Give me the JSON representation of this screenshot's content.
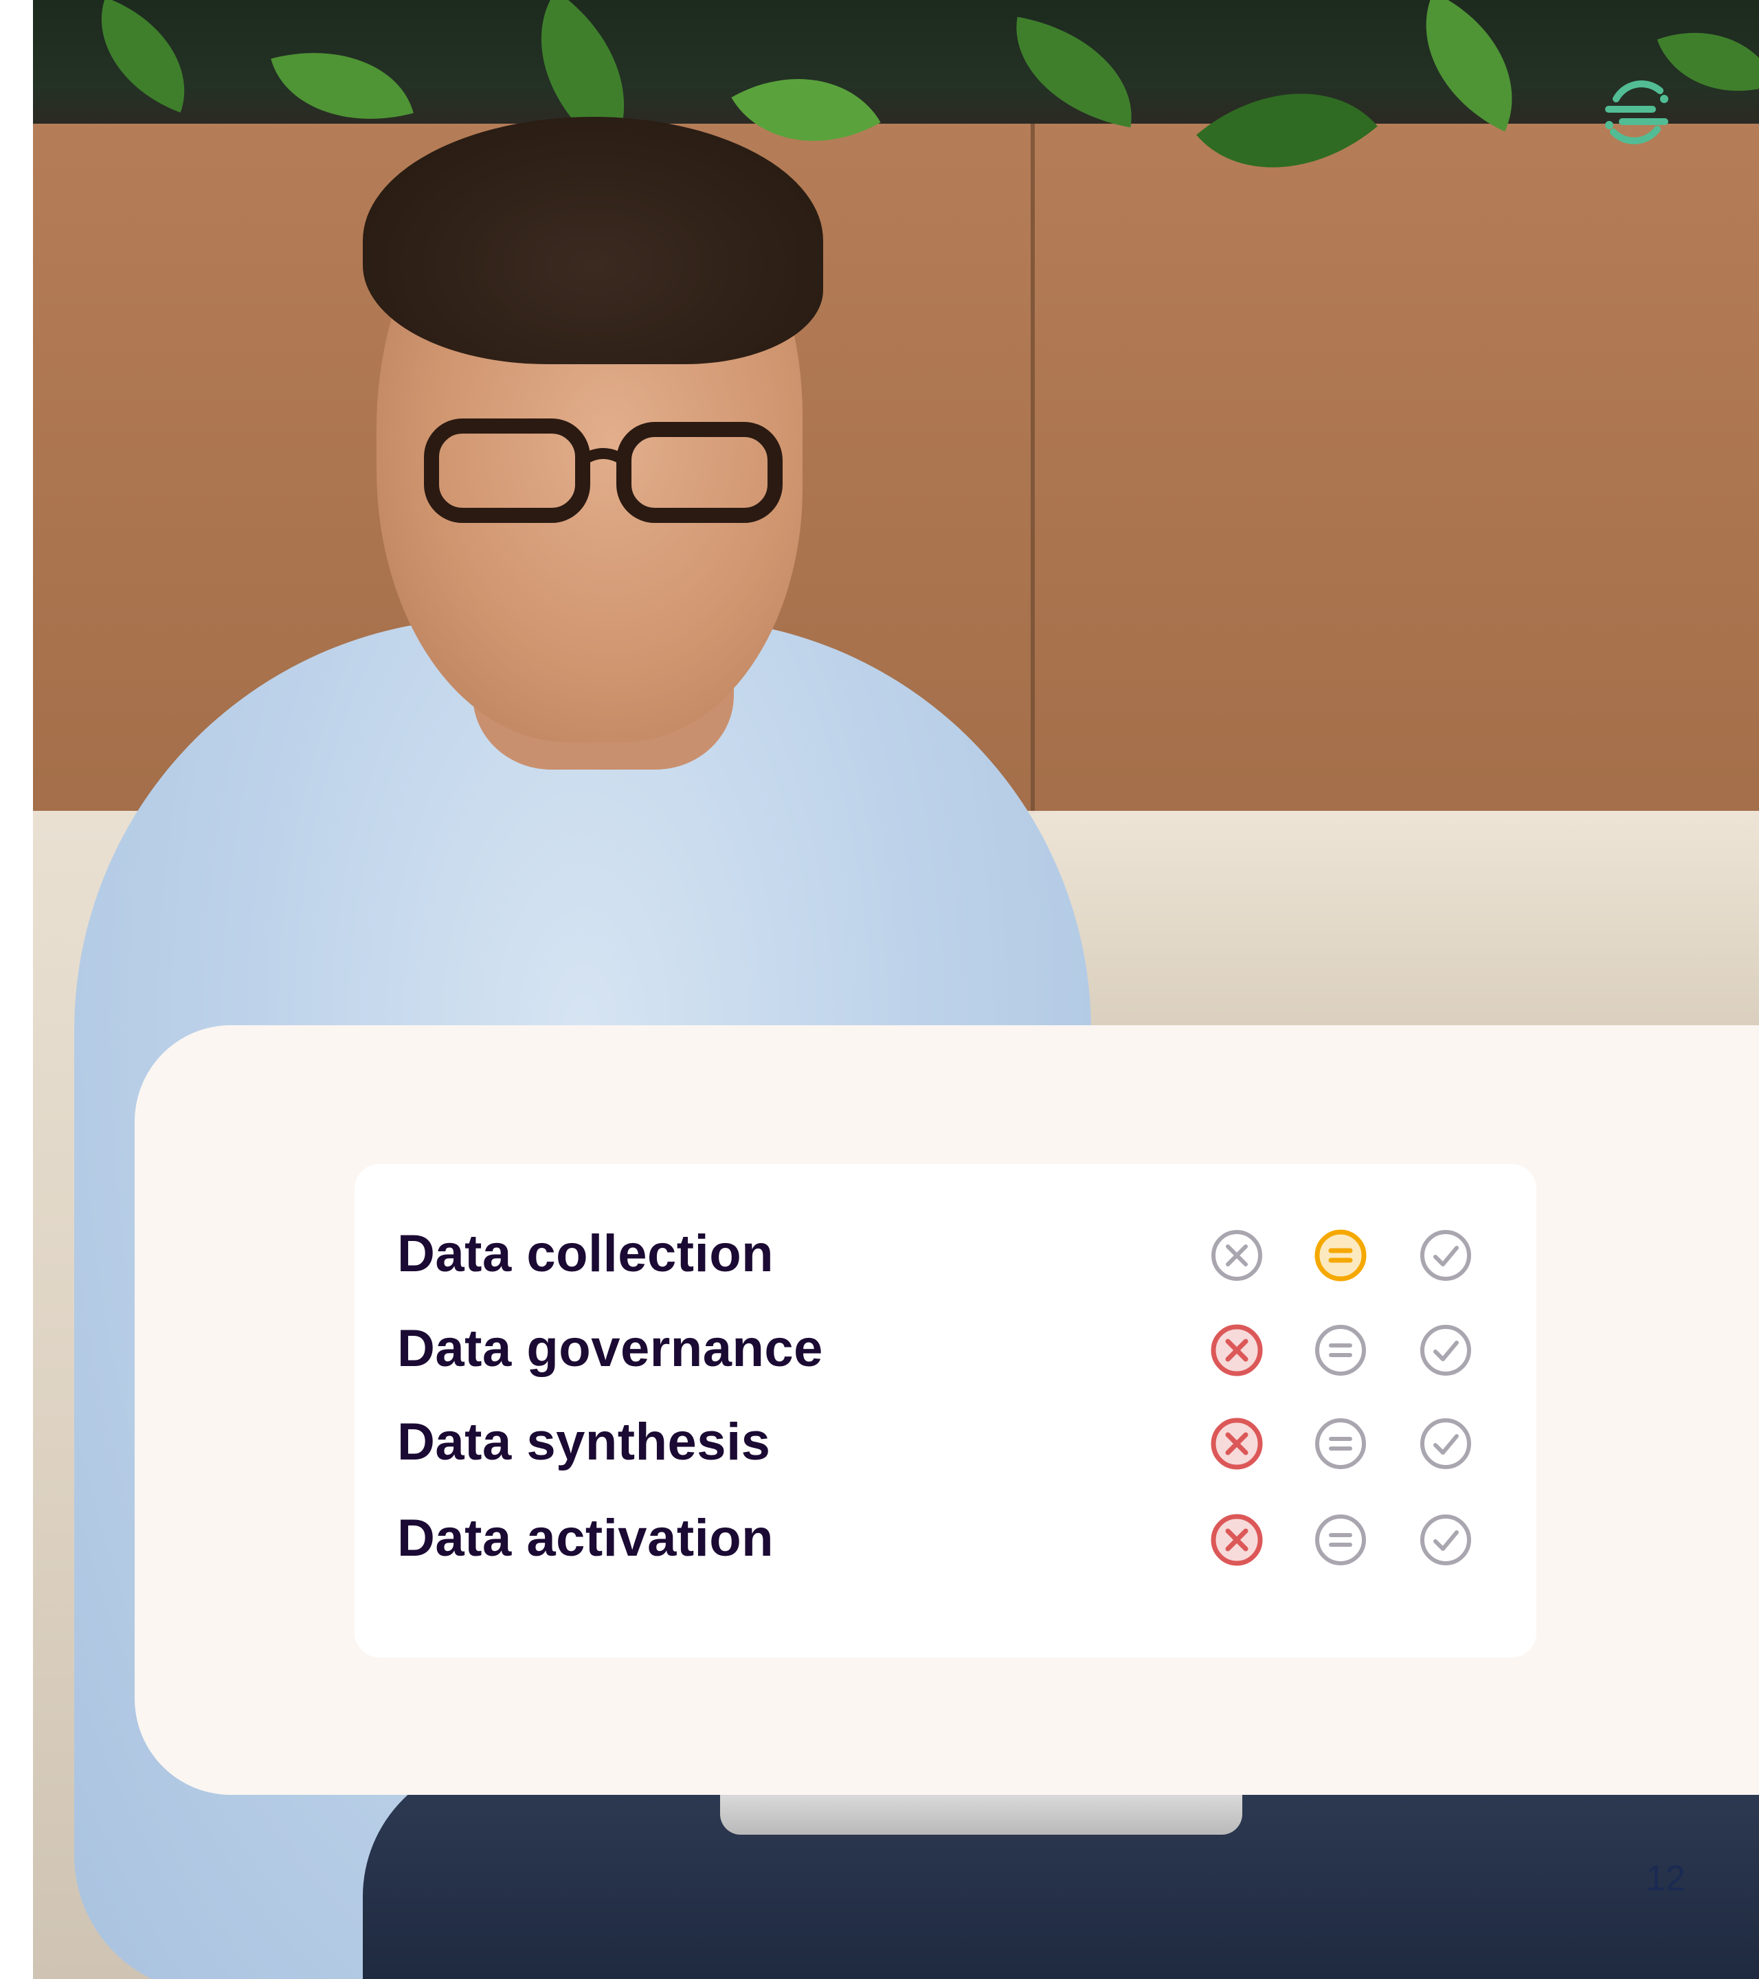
{
  "brand": {
    "logo_icon": "segment-logo-icon",
    "accent_color": "#52bd94"
  },
  "comparison": {
    "rows": [
      {
        "label": "Data collection",
        "status": "partial"
      },
      {
        "label": "Data governance",
        "status": "missing"
      },
      {
        "label": "Data synthesis",
        "status": "missing"
      },
      {
        "label": "Data activation",
        "status": "missing"
      }
    ],
    "icons": [
      "x-circle-icon",
      "equals-circle-icon",
      "check-circle-icon"
    ],
    "colors": {
      "missing": "#dc5858",
      "partial": "#f5a800",
      "neutral": "#a9a6b0"
    }
  },
  "page": {
    "number": "12"
  }
}
